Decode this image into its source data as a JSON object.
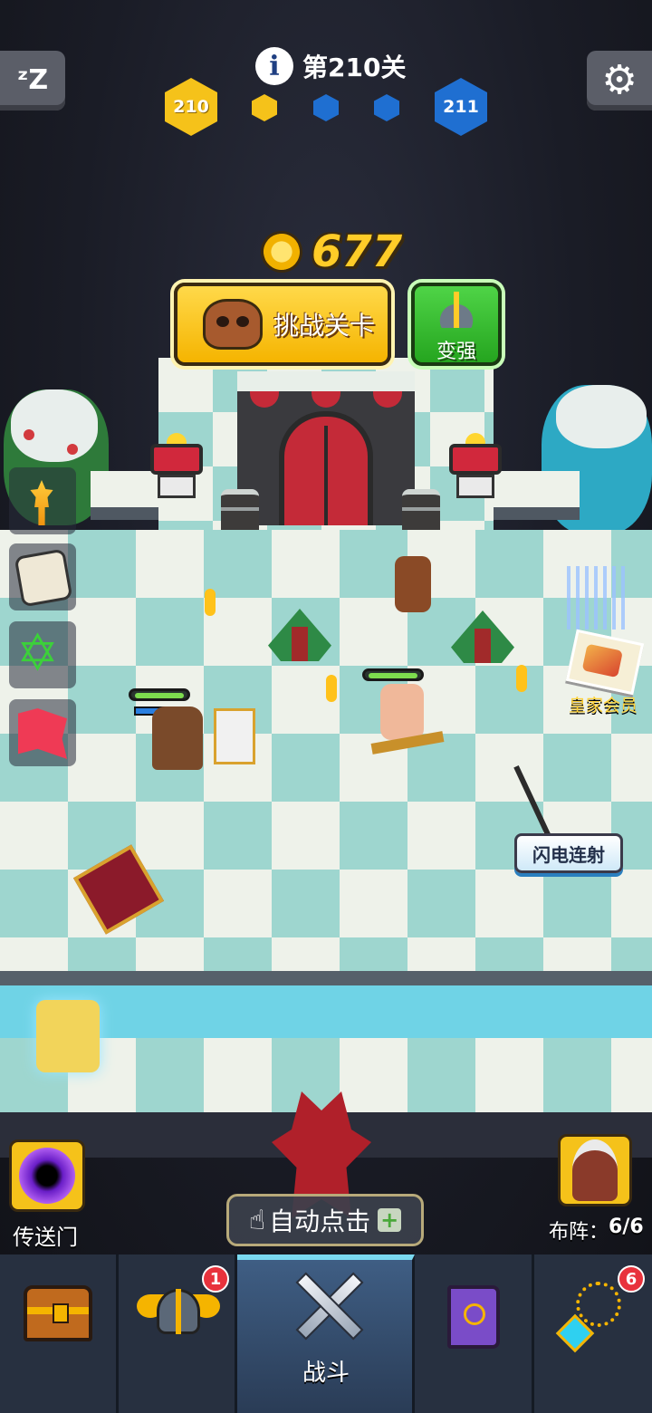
{
  "hud": {
    "level_title": "第210关",
    "current_level": "210",
    "next_level": "211",
    "coins": "677",
    "progress_nodes_filled": 1,
    "progress_nodes_total": 3
  },
  "buttons": {
    "challenge_label": "挑战关卡",
    "upgrade_label": "变强",
    "lightning_label": "闪电连射",
    "royal_member_label": "皇家会员",
    "portal_label": "传送门",
    "auto_click_label": "自动点击",
    "formation_label": "布阵：",
    "formation_value": "6/6"
  },
  "bottom_nav": {
    "tabs": [
      {
        "name": "chest",
        "icon": "treasure-chest-icon",
        "badge": ""
      },
      {
        "name": "hero",
        "icon": "winged-helmet-icon",
        "badge": "1"
      },
      {
        "name": "battle",
        "icon": "crossed-swords-icon",
        "label": "战斗"
      },
      {
        "name": "spellbook",
        "icon": "spellbook-icon",
        "badge": ""
      },
      {
        "name": "amulet",
        "icon": "amulet-icon",
        "badge": "6"
      }
    ]
  },
  "colors": {
    "gold": "#f5b400",
    "blue_hex": "#1f6fd1",
    "green_button": "#25a51f",
    "board_teal": "#9ed6cf"
  }
}
